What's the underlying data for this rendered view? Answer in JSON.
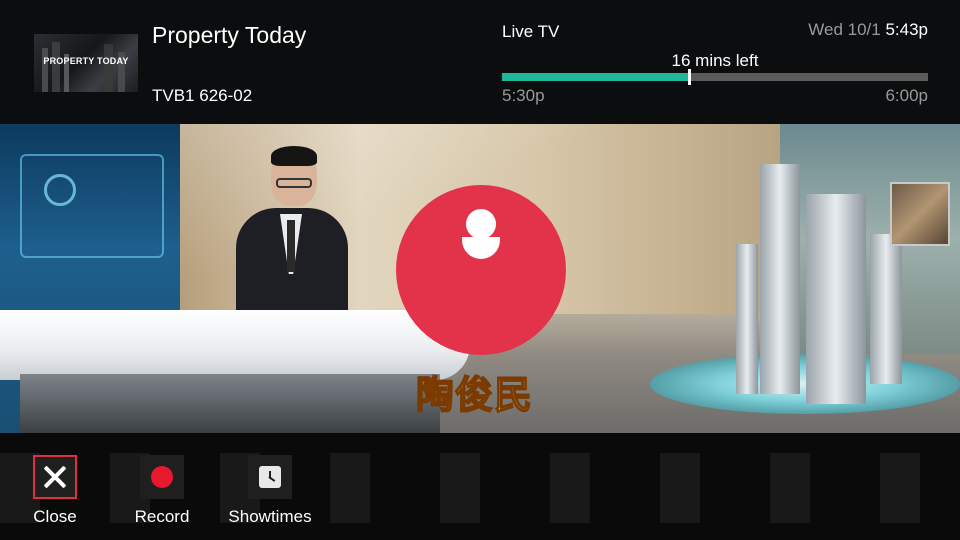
{
  "program": {
    "title": "Property Today",
    "channel": "TVB1 626-02",
    "thumbnail_text": "PROPERTY TODAY"
  },
  "live": {
    "label": "Live TV",
    "date": "Wed 10/1",
    "time": "5:43p",
    "remaining": "16 mins left",
    "start_time": "5:30p",
    "end_time": "6:00p",
    "progress_fraction": 0.44
  },
  "video": {
    "caption": "陶俊民"
  },
  "actions": [
    {
      "label": "Close",
      "icon": "close-icon",
      "focused": true
    },
    {
      "label": "Record",
      "icon": "record-icon",
      "focused": false
    },
    {
      "label": "Showtimes",
      "icon": "clock-icon",
      "focused": false
    }
  ],
  "colors": {
    "progress": "#1fb89a",
    "focus": "#e0303f",
    "record": "#e8192c",
    "logo": "#e3334b"
  }
}
